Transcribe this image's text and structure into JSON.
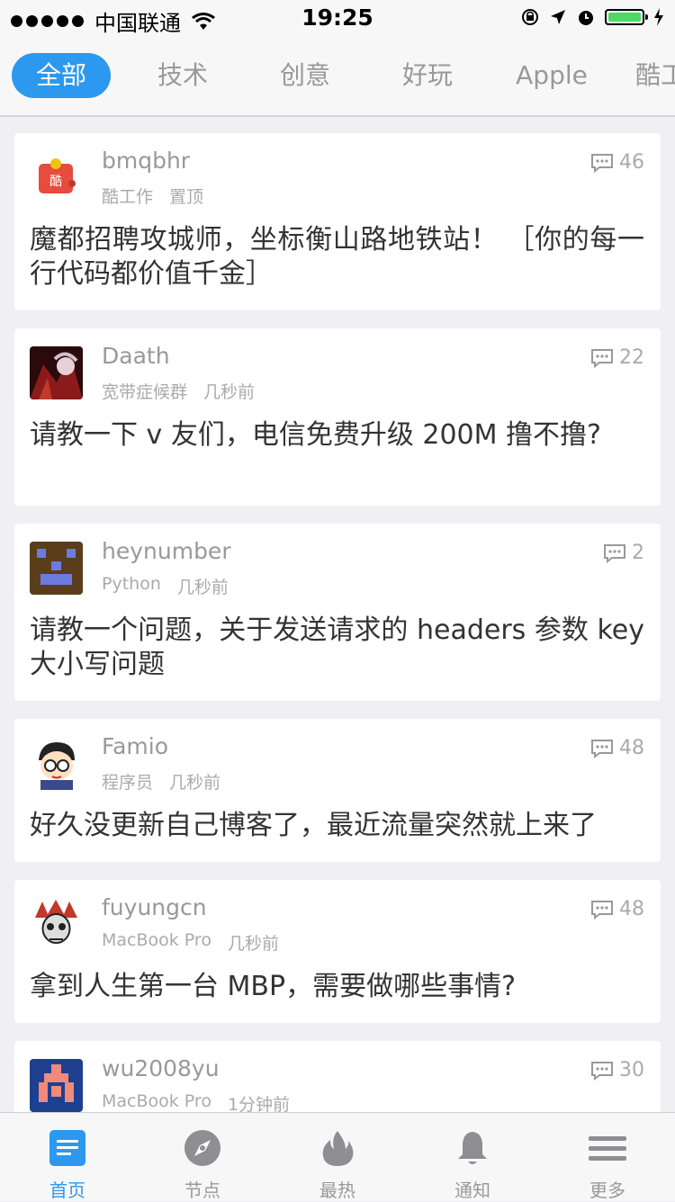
{
  "status_bar": {
    "carrier": "中国联通",
    "time": "19:25"
  },
  "tabs": [
    {
      "label": "全部",
      "active": true
    },
    {
      "label": "技术",
      "active": false
    },
    {
      "label": "创意",
      "active": false
    },
    {
      "label": "好玩",
      "active": false
    },
    {
      "label": "Apple",
      "active": false
    },
    {
      "label": "酷工",
      "active": false
    }
  ],
  "topics": [
    {
      "username": "bmqbhr",
      "node": "酷工作",
      "time": "置顶",
      "replies": "46",
      "title": "魔都招聘攻城师，坐标衡山路地铁站！ ［你的每一行代码都价值千金］"
    },
    {
      "username": "Daath",
      "node": "宽带症候群",
      "time": "几秒前",
      "replies": "22",
      "title": "请教一下 v 友们，电信免费升级 200M 撸不撸?"
    },
    {
      "username": "heynumber",
      "node": "Python",
      "time": "几秒前",
      "replies": "2",
      "title": "请教一个问题，关于发送请求的 headers 参数 key 大小写问题"
    },
    {
      "username": "Famio",
      "node": "程序员",
      "time": "几秒前",
      "replies": "48",
      "title": "好久没更新自己博客了，最近流量突然就上来了"
    },
    {
      "username": "fuyungcn",
      "node": "MacBook Pro",
      "time": "几秒前",
      "replies": "48",
      "title": "拿到人生第一台 MBP，需要做哪些事情?"
    },
    {
      "username": "wu2008yu",
      "node": "MacBook Pro",
      "time": "1分钟前",
      "replies": "30",
      "title": ""
    }
  ],
  "bottom_tabs": [
    {
      "label": "首页",
      "icon": "home-icon",
      "active": true
    },
    {
      "label": "节点",
      "icon": "compass-icon",
      "active": false
    },
    {
      "label": "最热",
      "icon": "flame-icon",
      "active": false
    },
    {
      "label": "通知",
      "icon": "bell-icon",
      "active": false
    },
    {
      "label": "更多",
      "icon": "menu-icon",
      "active": false
    }
  ],
  "colors": {
    "accent": "#2c98f0",
    "background": "#efeff4",
    "battery": "#4cd964"
  }
}
